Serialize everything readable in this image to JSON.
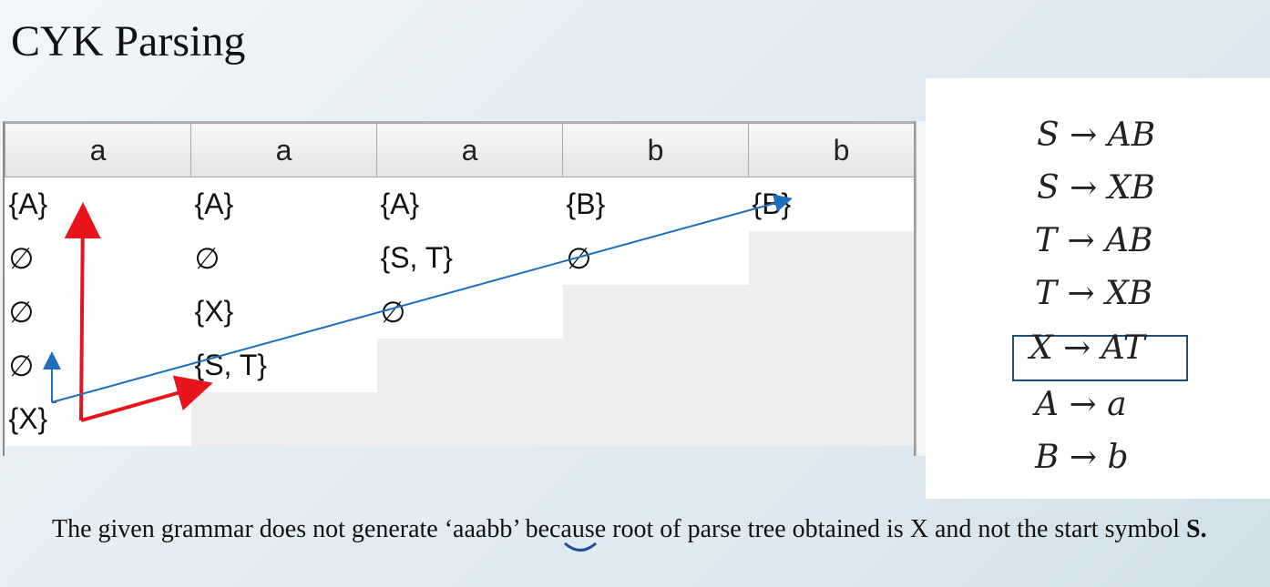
{
  "slide": {
    "title": "CYK Parsing"
  },
  "table": {
    "headers": [
      "a",
      "a",
      "a",
      "b",
      "b"
    ],
    "rows": [
      [
        "{A}",
        "{A}",
        "{A}",
        "{B}",
        "{B}"
      ],
      [
        "∅",
        "∅",
        "{S, T}",
        "∅",
        ""
      ],
      [
        "∅",
        "{X}",
        "∅",
        "",
        ""
      ],
      [
        "∅",
        "{S, T}",
        "",
        "",
        ""
      ],
      [
        "{X}",
        "",
        "",
        "",
        ""
      ]
    ]
  },
  "grammar": {
    "rules": [
      {
        "lhs": "S",
        "arrow": "→",
        "rhs": "AB"
      },
      {
        "lhs": "S",
        "arrow": "→",
        "rhs": "XB"
      },
      {
        "lhs": "T",
        "arrow": "→",
        "rhs": "AB"
      },
      {
        "lhs": "T",
        "arrow": "→",
        "rhs": "XB"
      },
      {
        "lhs": "X",
        "arrow": "→",
        "rhs": "AT"
      },
      {
        "lhs": "A",
        "arrow": "→",
        "rhs": "a"
      },
      {
        "lhs": "B",
        "arrow": "→",
        "rhs": "b"
      }
    ],
    "highlighted_rule_index": 4
  },
  "note": {
    "text_before": "The given grammar does not generate ‘aaabb’ because root of parse tree obtained is X and not the start symbol ",
    "start_symbol": "S."
  },
  "annotation_colors": {
    "red": "#e8141b",
    "blue": "#1f6fbf"
  }
}
